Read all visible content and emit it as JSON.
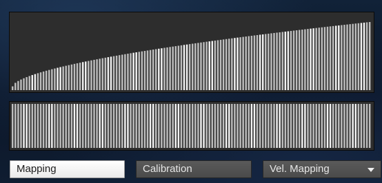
{
  "controls": {
    "mapping_tab_label": "Mapping",
    "calibration_tab_label": "Calibration",
    "velocity_mapping_select_value": "Vel. Mapping",
    "velocity_mapping_select_icon": "chevron-down-icon"
  },
  "colors": {
    "panel_background": "#2d2d2d",
    "bar_primary": "#bdbdbd",
    "bar_highlight": "#f2f2f2",
    "active_tab_background": "#ffffff",
    "inactive_tab_background": "#525252"
  },
  "velocity_curve": {
    "bar_count": 128,
    "start_level": 0.05,
    "end_level": 0.9,
    "curve_exponent": 0.6
  }
}
